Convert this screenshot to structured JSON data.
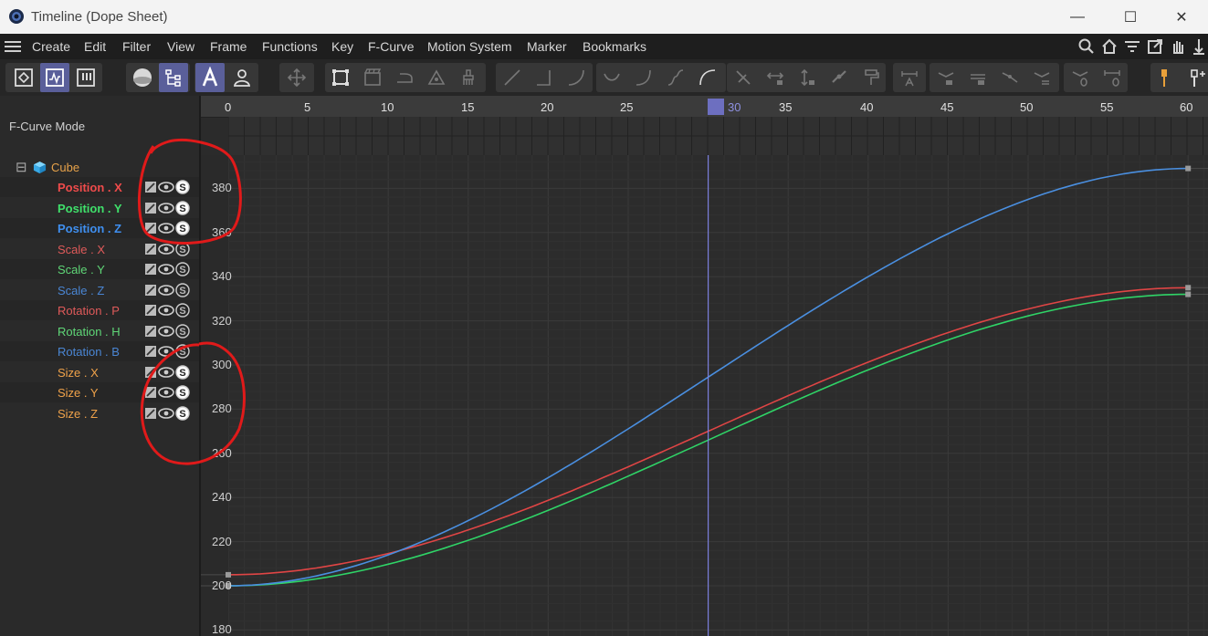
{
  "window": {
    "title": "Timeline (Dope Sheet)",
    "minimize_glyph": "—",
    "maximize_glyph": "☐",
    "close_glyph": "✕"
  },
  "menu": [
    "Create",
    "Edit",
    "Filter",
    "View",
    "Frame",
    "Functions",
    "Key",
    "F-Curve",
    "Motion System",
    "Marker",
    "Bookmarks"
  ],
  "toolbar_icons_right": [
    "search-icon",
    "home-icon",
    "filter-icon",
    "open-window-icon",
    "hand-icon",
    "pin-icon"
  ],
  "left_panel": {
    "mode_label": "F-Curve Mode",
    "object": {
      "name": "Cube",
      "collapse_glyph": "⊟",
      "color": "#e7a24a"
    },
    "tracks": [
      {
        "label": "Position . X",
        "color": "#ef4b4b",
        "bold": true,
        "solo_active": true
      },
      {
        "label": "Position . Y",
        "color": "#3fe06a",
        "bold": true,
        "solo_active": true
      },
      {
        "label": "Position . Z",
        "color": "#3f8ff0",
        "bold": true,
        "solo_active": true
      },
      {
        "label": "Scale . X",
        "color": "#e05a5a",
        "bold": false,
        "solo_active": false
      },
      {
        "label": "Scale . Y",
        "color": "#5fd777",
        "bold": false,
        "solo_active": false
      },
      {
        "label": "Scale . Z",
        "color": "#4a86d4",
        "bold": false,
        "solo_active": false
      },
      {
        "label": "Rotation . P",
        "color": "#e05a5a",
        "bold": false,
        "solo_active": false
      },
      {
        "label": "Rotation . H",
        "color": "#5fd777",
        "bold": false,
        "solo_active": false
      },
      {
        "label": "Rotation . B",
        "color": "#4a86d4",
        "bold": false,
        "solo_active": false
      },
      {
        "label": "Size . X",
        "color": "#efa24a",
        "bold": false,
        "solo_active": true
      },
      {
        "label": "Size . Y",
        "color": "#efa24a",
        "bold": false,
        "solo_active": true
      },
      {
        "label": "Size . Z",
        "color": "#efa24a",
        "bold": false,
        "solo_active": true
      }
    ],
    "solo_glyph": "S"
  },
  "timeline": {
    "frame_ticks": [
      "0",
      "5",
      "10",
      "15",
      "20",
      "25",
      "30",
      "35",
      "40",
      "45",
      "50",
      "55",
      "60"
    ],
    "current_frame": "30",
    "frame_min": 0,
    "frame_max": 60
  },
  "chart_data": {
    "type": "line",
    "y_ticks": [
      "380",
      "360",
      "340",
      "320",
      "300",
      "280",
      "260",
      "240",
      "220",
      "200",
      "180"
    ],
    "x_range": [
      0,
      60
    ],
    "y_range": [
      180,
      390
    ],
    "grid": true,
    "series": [
      {
        "name": "Position . X",
        "color": "#e04545",
        "start": [
          0,
          205
        ],
        "end": [
          60,
          335
        ]
      },
      {
        "name": "Position . Y",
        "color": "#2fd467",
        "start": [
          0,
          200
        ],
        "end": [
          60,
          332
        ]
      },
      {
        "name": "Position . Z",
        "color": "#4a8fe0",
        "start": [
          0,
          200
        ],
        "end": [
          60,
          389
        ]
      }
    ]
  },
  "annotations": {
    "color": "#e01a1a"
  }
}
